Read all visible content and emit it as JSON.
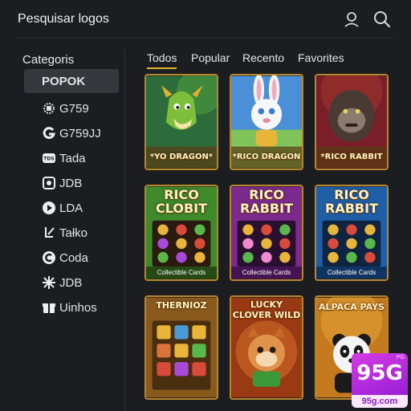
{
  "header": {
    "search_label": "Pesquisar logos",
    "icons": [
      "user-icon",
      "search-icon"
    ]
  },
  "sidebar": {
    "title": "Categoris",
    "items": [
      {
        "label": "POPOK",
        "icon": "none",
        "active": true
      },
      {
        "label": "G759",
        "icon": "gear-badge-icon"
      },
      {
        "label": "G759JJ",
        "icon": "g-logo-icon"
      },
      {
        "label": "Tada",
        "icon": "tds-badge-icon"
      },
      {
        "label": "JDB",
        "icon": "target-icon"
      },
      {
        "label": "LDA",
        "icon": "play-icon"
      },
      {
        "label": "Tałko",
        "icon": "wand-icon"
      },
      {
        "label": "Coda",
        "icon": "c-logo-icon"
      },
      {
        "label": "JDB",
        "icon": "cross-pattern-icon"
      },
      {
        "label": "Uinhos",
        "icon": "gift-icon"
      }
    ]
  },
  "tabs": [
    {
      "label": "Todos",
      "active": true
    },
    {
      "label": "Popular"
    },
    {
      "label": "Recento"
    },
    {
      "label": "Favorites"
    }
  ],
  "games": [
    {
      "title": "*YO DRAGON*",
      "subtitle": "",
      "theme": "dragon",
      "bg": "#2c6b3a"
    },
    {
      "title": "*RICO DRAGON",
      "subtitle": "",
      "theme": "rabbit",
      "bg": "#4a8fd8"
    },
    {
      "title": "*RICO RABBIT",
      "subtitle": "",
      "theme": "gorilla",
      "bg": "#7a1e2a"
    },
    {
      "title": "RICO CLOBIT",
      "subtitle": "Collectible Cards",
      "theme": "slot",
      "bg": "#3f8a2a"
    },
    {
      "title": "RICO RABBIT",
      "subtitle": "Collectible Cards",
      "theme": "slot",
      "bg": "#7c2a8e"
    },
    {
      "title": "RICO RABBIT",
      "subtitle": "Collectible Cards",
      "theme": "slot",
      "bg": "#1f5fa8"
    },
    {
      "title": "THERNIOZ",
      "subtitle": "",
      "theme": "slot-gold",
      "bg": "#8a5a1c"
    },
    {
      "title": "LUCKY CLOVER WILD",
      "subtitle": "",
      "theme": "critter",
      "bg": "#9a3a14"
    },
    {
      "title": "ALPACA PAYS",
      "subtitle": "",
      "theme": "panda",
      "bg": "#c67a1e"
    }
  ],
  "badge": {
    "corner": "PG",
    "logo": "95G",
    "domain": "95g.com"
  },
  "colors": {
    "background": "#1c1d21",
    "active_tab_underline": "#e4b62c",
    "card_border": "#b8862a",
    "badge_purple": "#a42bdc"
  }
}
